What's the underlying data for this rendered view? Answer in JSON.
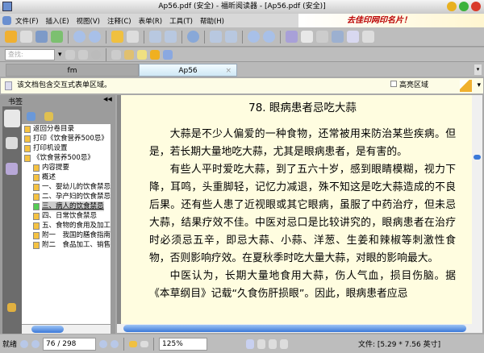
{
  "window": {
    "title": "Ap56.pdf (安全) - 福昕阅读器 - [Ap56.pdf (安全)]"
  },
  "menu": [
    "文件(F)",
    "插入(E)",
    "视图(V)",
    "注释(C)",
    "表单(R)",
    "工具(T)",
    "帮助(H)"
  ],
  "ad": {
    "text": "去佳印网印名片！"
  },
  "toolbar": {
    "search_placeholder": "查找:"
  },
  "tabs": [
    {
      "label": "fm",
      "active": false
    },
    {
      "label": "Ap56",
      "active": true
    }
  ],
  "infobar": {
    "message": "该文档包含交互式表单区域。",
    "highlight_label": "高亮区域"
  },
  "sidebar": {
    "title": "书签",
    "bookmarks": [
      {
        "label": "返回分卷目录",
        "level": 0
      },
      {
        "label": "打印《饮食营养500忌》",
        "level": 0
      },
      {
        "label": "打印机设置",
        "level": 0
      },
      {
        "label": "《饮食营养500忌》",
        "level": 0
      },
      {
        "label": "内容提要",
        "level": 1
      },
      {
        "label": "概述",
        "level": 1
      },
      {
        "label": "一、婴幼儿的饮食禁忌",
        "level": 1
      },
      {
        "label": "二、孕产妇的饮食禁忌",
        "level": 1
      },
      {
        "label": "三、病人的饮食禁忌",
        "level": 1,
        "selected": true
      },
      {
        "label": "四、日常饮食禁忌",
        "level": 1
      },
      {
        "label": "五、食物的食用及加工",
        "level": 1
      },
      {
        "label": "附一　我国的膳食指南",
        "level": 1
      },
      {
        "label": "附二　食品加工、销售",
        "level": 1
      }
    ]
  },
  "document": {
    "title": "78.  眼病患者忌吃大蒜",
    "paragraphs": [
      "大蒜是不少人偏爱的一种食物，还常被用来防治某些疾病。但是，若长期大量地吃大蒜，尤其是眼病患者，是有害的。",
      "有些人平时爱吃大蒜，到了五六十岁，感到眼睛模糊，视力下降，耳鸣，头重脚轻，记忆力减退，殊不知这是吃大蒜造成的不良后果。还有些人患了近视眼或其它眼病，虽服了中药治疗，但未忌大蒜，结果疗效不佳。中医对忌口是比较讲究的，眼病患者在治疗时必须忌五辛，即忌大蒜、小蒜、洋葱、生姜和辣椒等刺激性食物，否则影响疗效。在夏秋季时吃大量大蒜，对眼的影响最大。",
      "中医认为，长期大量地食用大蒜，伤人气血，损目伤脑。据《本草纲目》记载“久食伤肝损眼”。因此，眼病患者应忌"
    ]
  },
  "status": {
    "ready": "就绪",
    "page": "76 / 298",
    "zoom": "125%",
    "filesize": "文件: [5.29 * 7.56 英寸]"
  }
}
